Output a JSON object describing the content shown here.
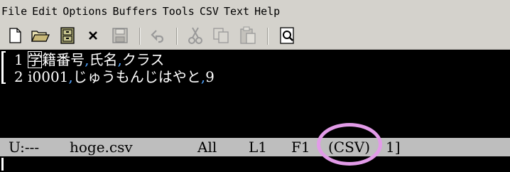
{
  "menu": [
    "File",
    "Edit",
    "Options",
    "Buffers",
    "Tools",
    "CSV",
    "Text",
    "Help"
  ],
  "toolbar": {
    "icons": [
      "new-file-icon",
      "open-folder-icon",
      "save-cabinet-icon",
      "close-icon",
      "save-disk-icon",
      "undo-icon",
      "cut-icon",
      "copy-icon",
      "paste-icon",
      "search-icon"
    ]
  },
  "buffer": {
    "lines": [
      {
        "num": "1",
        "fields": [
          "学籍番号",
          "氏名",
          "クラス"
        ]
      },
      {
        "num": "2",
        "fields": [
          "i0001",
          "じゅうもんじはやと",
          "9"
        ]
      }
    ],
    "separator": ","
  },
  "modeline": {
    "status": "U:---",
    "filename": "hoge.csv",
    "position": "All",
    "line": "L1",
    "field": "F1",
    "mode": "(CSV)",
    "extra": "1]"
  },
  "colors": {
    "comma": "#4fa3ff",
    "highlight": "#e29be8"
  }
}
